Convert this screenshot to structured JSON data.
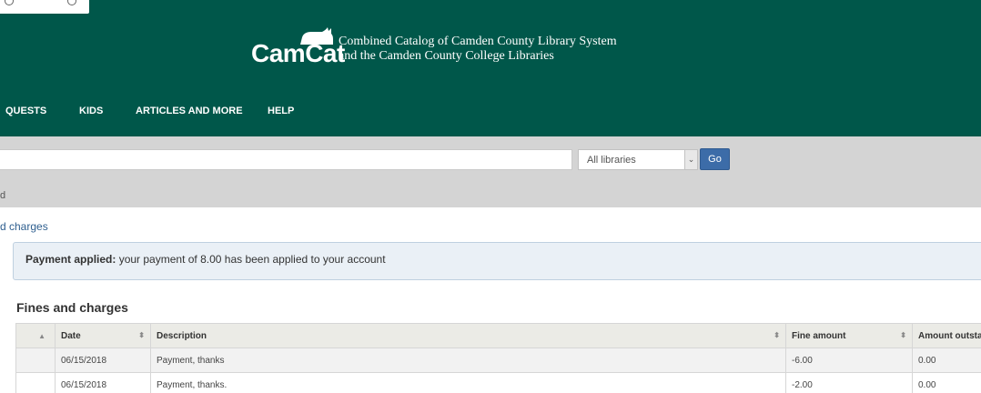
{
  "header": {
    "logo_text": "CamCat",
    "tagline_line1": "Combined Catalog of Camden County Library System",
    "tagline_line2": "and the Camden County College Libraries",
    "background": "#00574a"
  },
  "nav": {
    "items": [
      "QUESTS",
      "KIDS",
      "ARTICLES AND MORE",
      "HELP"
    ]
  },
  "search": {
    "input_value": "",
    "library_selected": "All libraries",
    "go_label": "Go",
    "band_text": "d"
  },
  "main": {
    "breadcrumb": "d charges",
    "alert": {
      "title": "Payment applied:",
      "message": "your payment of 8.00 has been applied to your account"
    },
    "section_title": "Fines and charges",
    "table": {
      "headers": [
        "Date",
        "Description",
        "Fine amount",
        "Amount outsta"
      ],
      "rows": [
        {
          "date": "06/15/2018",
          "description": "Payment, thanks",
          "fine_amount": "-6.00",
          "outstanding": "0.00"
        },
        {
          "date": "06/15/2018",
          "description": "Payment, thanks.",
          "fine_amount": "-2.00",
          "outstanding": "0.00"
        }
      ]
    }
  },
  "icons": {
    "sort": "sort-icon",
    "sort_asc": "sort-ascending-icon",
    "dropdown": "chevron-down-icon"
  },
  "colors": {
    "accent": "#00574a",
    "go_button": "#3c6ca8",
    "alert_bg": "#eaf0f6"
  }
}
